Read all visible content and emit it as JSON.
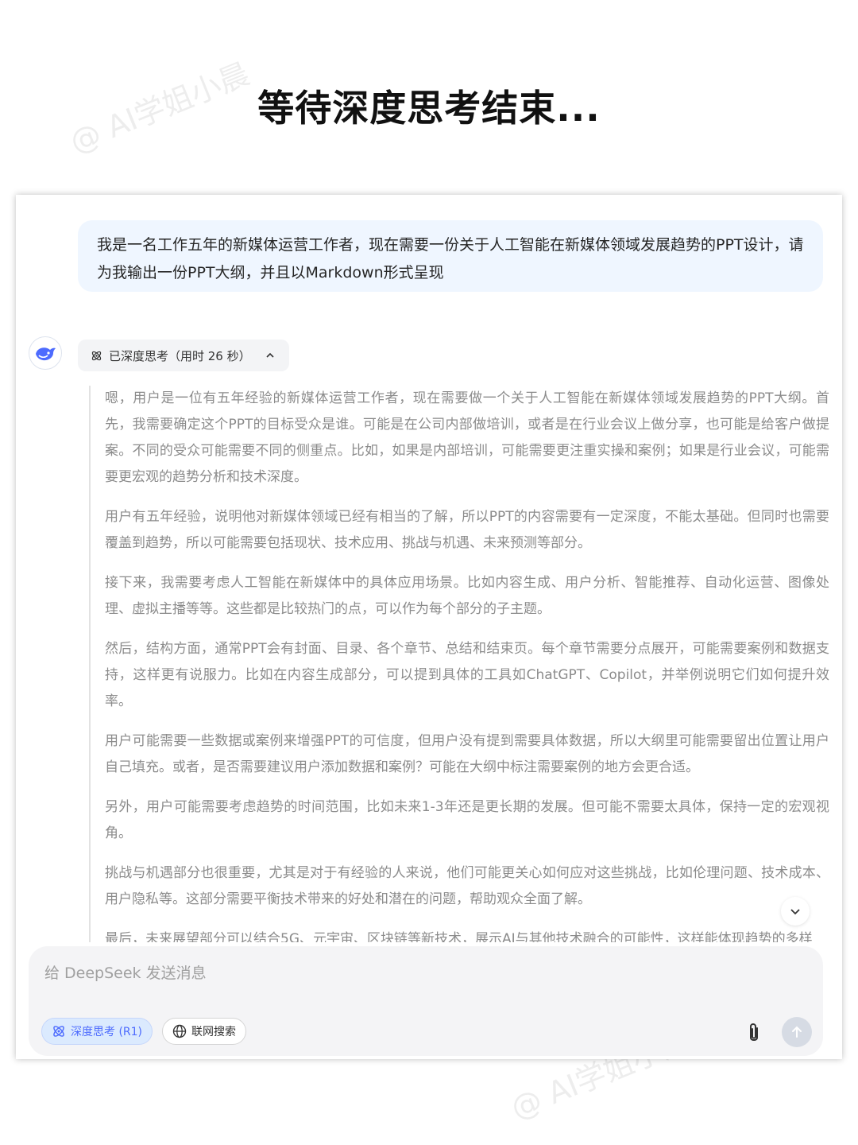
{
  "page": {
    "title": "等待深度思考结束...",
    "watermark": "@ AI学姐小晨"
  },
  "chat": {
    "user_message": "我是一名工作五年的新媒体运营工作者，现在需要一份关于人工智能在新媒体领域发展趋势的PPT设计，请为我输出一份PPT大纲，并且以Markdown形式呈现",
    "thinking_label": "已深度思考（用时 26 秒）",
    "thinking_paragraphs": [
      "嗯，用户是一位有五年经验的新媒体运营工作者，现在需要做一个关于人工智能在新媒体领域发展趋势的PPT大纲。首先，我需要确定这个PPT的目标受众是谁。可能是在公司内部做培训，或者是在行业会议上做分享，也可能是给客户做提案。不同的受众可能需要不同的侧重点。比如，如果是内部培训，可能需要更注重实操和案例；如果是行业会议，可能需要更宏观的趋势分析和技术深度。",
      "用户有五年经验，说明他对新媒体领域已经有相当的了解，所以PPT的内容需要有一定深度，不能太基础。但同时也需要覆盖到趋势，所以可能需要包括现状、技术应用、挑战与机遇、未来预测等部分。",
      "接下来，我需要考虑人工智能在新媒体中的具体应用场景。比如内容生成、用户分析、智能推荐、自动化运营、图像处理、虚拟主播等等。这些都是比较热门的点，可以作为每个部分的子主题。",
      "然后，结构方面，通常PPT会有封面、目录、各个章节、总结和结束页。每个章节需要分点展开，可能需要案例和数据支持，这样更有说服力。比如在内容生成部分，可以提到具体的工具如ChatGPT、Copilot，并举例说明它们如何提升效率。",
      "用户可能需要一些数据或案例来增强PPT的可信度，但用户没有提到需要具体数据，所以大纲里可能需要留出位置让用户自己填充。或者，是否需要建议用户添加数据和案例？可能在大纲中标注需要案例的地方会更合适。",
      "另外，用户可能需要考虑趋势的时间范围，比如未来1-3年还是更长期的发展。但可能不需要太具体，保持一定的宏观视角。",
      "挑战与机遇部分也很重要，尤其是对于有经验的人来说，他们可能更关心如何应对这些挑战，比如伦理问题、技术成本、用户隐私等。这部分需要平衡技术带来的好处和潜在的问题，帮助观众全面了解。",
      "最后，未来展望部分可以结合5G、元宇宙、区块链等新技术，展示AI与其他技术融合的可能性，这样能体现趋势的多样"
    ]
  },
  "composer": {
    "placeholder": "给 DeepSeek 发送消息",
    "deep_think_label": "深度思考 (R1)",
    "web_search_label": "联网搜索"
  },
  "colors": {
    "accent": "#4d6bfe",
    "user_bubble": "#eff6ff",
    "thinking_text": "#8b8b8b"
  },
  "icons": {
    "avatar": "deepseek-whale-icon",
    "thinking": "atom-icon",
    "collapse": "chevron-up-icon",
    "scroll": "chevron-down-icon",
    "web": "globe-icon",
    "attach": "paperclip-icon",
    "send": "arrow-up-icon"
  }
}
